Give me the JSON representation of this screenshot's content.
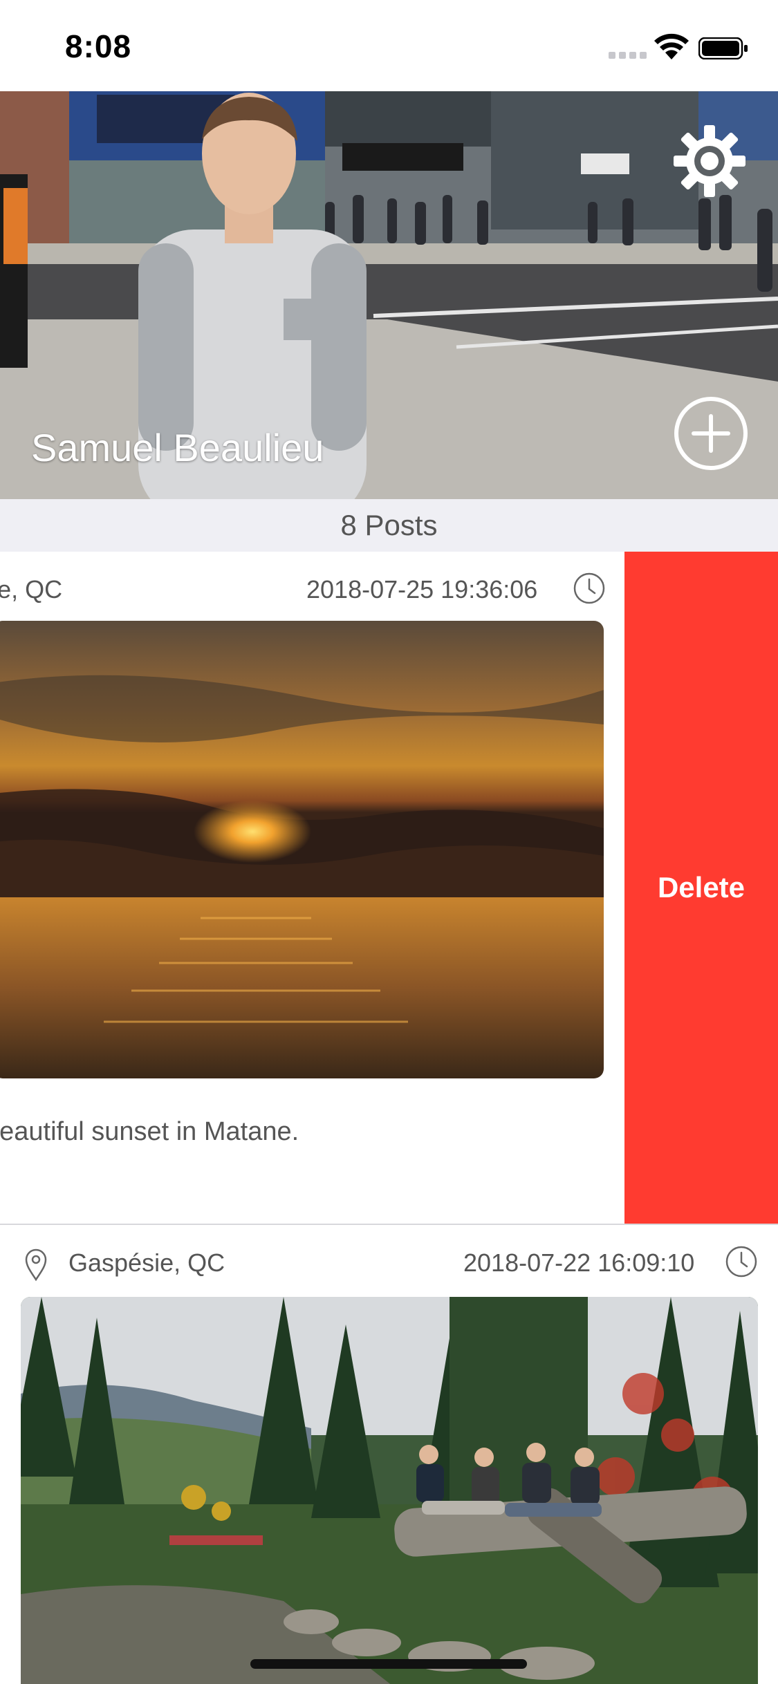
{
  "status_bar": {
    "time": "8:08",
    "icons": [
      "cellular-signal-icon",
      "wifi-icon",
      "battery-icon"
    ]
  },
  "profile": {
    "name": "Samuel Beaulieu",
    "settings_icon": "gear-icon",
    "add_icon": "plus-circle-icon"
  },
  "posts": {
    "count_label": "8 Posts",
    "items": [
      {
        "location": "onne, QC",
        "timestamp": "2018-07-25 19:36:06",
        "caption": "beautiful sunset in Matane.",
        "photo": "sunset-over-water-photo"
      },
      {
        "location": "Gaspésie, QC",
        "timestamp": "2018-07-22 16:09:10",
        "photo": "friends-on-log-forest-river-photo"
      }
    ]
  },
  "swipe_action": {
    "delete_label": "Delete",
    "color": "#ff3b30"
  },
  "colors": {
    "posts_bar_bg": "#efeff4",
    "text_gray": "#555555",
    "delete_red": "#ff3b30"
  }
}
